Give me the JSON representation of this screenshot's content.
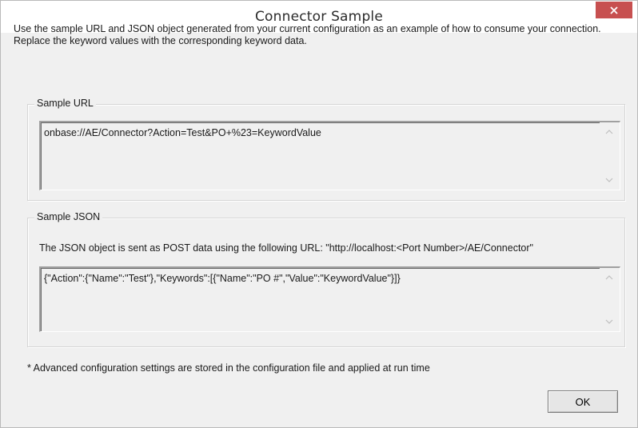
{
  "window": {
    "title": "Connector Sample",
    "close_icon": "close-icon"
  },
  "description": "Use the sample URL and JSON object generated from your current configuration as an example of how to consume your connection.  Replace the keyword values with the corresponding keyword data.",
  "sample_url": {
    "legend": "Sample URL",
    "value": "onbase://AE/Connector?Action=Test&PO+%23=KeywordValue"
  },
  "sample_json": {
    "legend": "Sample JSON",
    "note": "The JSON object is sent as POST data using the following URL: \"http://localhost:<Port Number>/AE/Connector\"",
    "value": "{\"Action\":{\"Name\":\"Test\"},\"Keywords\":[{\"Name\":\"PO #\",\"Value\":\"KeywordValue\"}]}"
  },
  "footnote": "* Advanced configuration settings are stored in the configuration file and applied at run time",
  "buttons": {
    "ok_label": "OK"
  },
  "colors": {
    "close_button_bg": "#c75050",
    "dialog_bg": "#f0f0f0"
  }
}
